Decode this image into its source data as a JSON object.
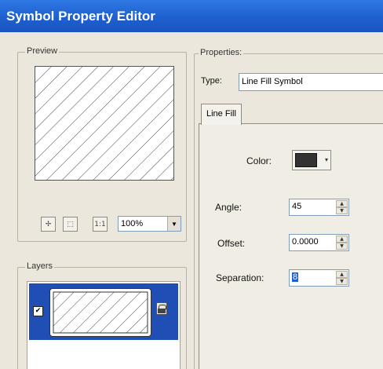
{
  "window": {
    "title": "Symbol Property Editor"
  },
  "preview": {
    "group_label": "Preview",
    "zoom_value": "100%",
    "tools": [
      "zoom-fit-icon",
      "zoom-extent-icon",
      "actual-size-icon"
    ]
  },
  "layers": {
    "group_label": "Layers",
    "items": [
      {
        "visible": true,
        "icon": "line-fill-thumbnail",
        "action_icon": "lock-icon"
      }
    ]
  },
  "properties": {
    "group_label": "Properties:",
    "type_label": "Type:",
    "type_value": "Line Fill Symbol",
    "tab_label": "Line Fill",
    "color_label": "Color:",
    "color_value": "#333333",
    "angle_label": "Angle:",
    "angle_value": "45",
    "offset_label": "Offset:",
    "offset_value": "0.0000",
    "separation_label": "Separation:",
    "separation_value": "8"
  }
}
